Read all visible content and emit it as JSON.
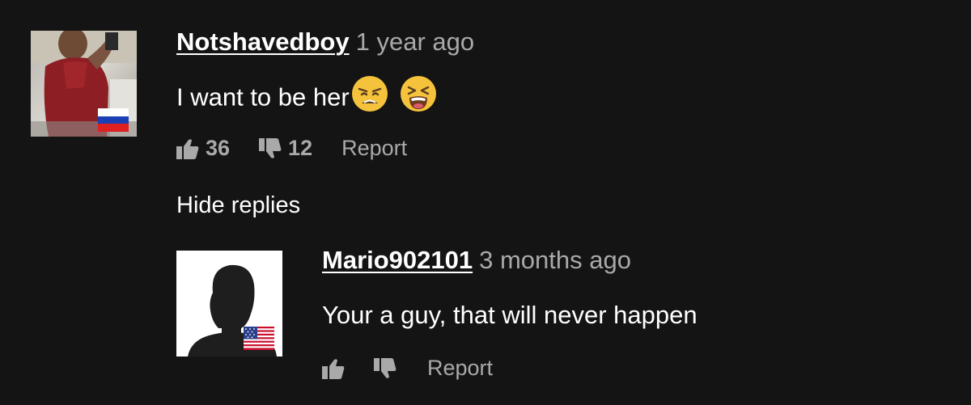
{
  "comments": [
    {
      "username": "Notshavedboy",
      "timestamp": "1 year ago",
      "text": "I want to be her",
      "emojis": [
        "weary-face",
        "tired-face"
      ],
      "likes": "36",
      "dislikes": "12",
      "report_label": "Report",
      "flag": "russia",
      "avatar": "user-photo"
    }
  ],
  "hide_replies_label": "Hide replies",
  "replies": [
    {
      "username": "Mario902101",
      "timestamp": "3 months ago",
      "text": "Your a guy, that will never happen",
      "likes": "",
      "dislikes": "",
      "report_label": "Report",
      "flag": "usa",
      "avatar": "default-silhouette"
    }
  ],
  "colors": {
    "background": "#141414",
    "text_primary": "#ffffff",
    "text_secondary": "#a9a9a9",
    "emoji_yellow": "#f5c33b"
  }
}
